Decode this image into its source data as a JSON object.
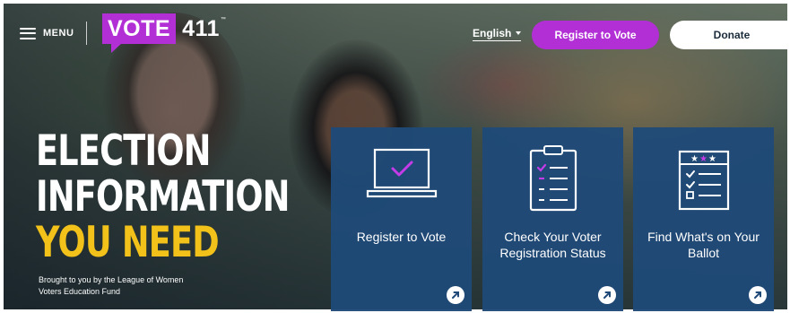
{
  "header": {
    "menu_label": "MENU",
    "logo": {
      "vote": "VOTE",
      "number": "411",
      "tm": "™"
    },
    "language": "English",
    "register_button": "Register to Vote",
    "donate_button": "Donate"
  },
  "hero": {
    "headline_line1": "ELECTION",
    "headline_line2": "INFORMATION",
    "headline_line3": "YOU NEED",
    "tagline": "Brought to you by the League of Women Voters Education Fund"
  },
  "cards": [
    {
      "title": "Register to Vote",
      "icon": "laptop-checkmark-icon"
    },
    {
      "title": "Check Your Voter Registration Status",
      "icon": "clipboard-checklist-icon"
    },
    {
      "title": "Find What's on Your Ballot",
      "icon": "ballot-icon"
    }
  ],
  "colors": {
    "brand_purple": "#b22fd6",
    "headline_yellow": "#f2c21a",
    "card_blue": "#1f4a78"
  }
}
